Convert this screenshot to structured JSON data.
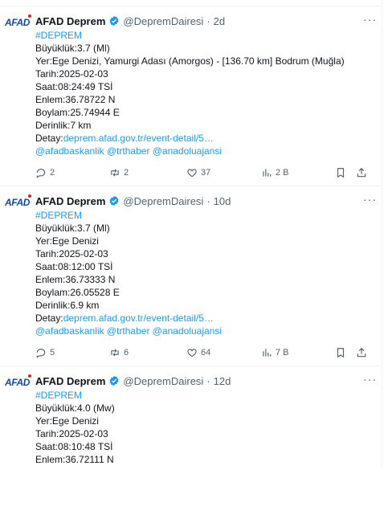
{
  "tweets": [
    {
      "author": "AFAD Deprem",
      "handle": "@DepremDairesi",
      "time": "2d",
      "avatar_text": "AFAD",
      "hashtag": "#DEPREM",
      "lines": [
        "Büyüklük:3.7 (Ml)",
        "Yer:Ege Denizi, Yamurgi Adası (Amorgos) - [136.70 km] Bodrum (Muğla)",
        "Tarih:2025-02-03",
        "Saat:08:24:49 TSİ",
        "Enlem:36.78722 N",
        "Boylam:25.74944 E",
        "Derinlik:7 km"
      ],
      "detail_label": "Detay:",
      "detail_link": "deprem.afad.gov.tr/event-detail/5…",
      "mentions": "@afadbaskanlik @trthaber @anadoluajansi",
      "replies": "2",
      "retweets": "2",
      "likes": "37",
      "views": "2 B"
    },
    {
      "author": "AFAD Deprem",
      "handle": "@DepremDairesi",
      "time": "10d",
      "avatar_text": "AFAD",
      "hashtag": "#DEPREM",
      "lines": [
        "Büyüklük:3.7 (Ml)",
        "Yer:Ege Denizi",
        "Tarih:2025-02-03",
        "Saat:08:12:00 TSİ",
        "Enlem:36.73333 N",
        "Boylam:26.05528 E",
        "Derinlik:6.9 km"
      ],
      "detail_label": "Detay:",
      "detail_link": "deprem.afad.gov.tr/event-detail/5…",
      "mentions": "@afadbaskanlik @trthaber @anadoluajansi",
      "replies": "5",
      "retweets": "6",
      "likes": "64",
      "views": "7 B"
    },
    {
      "author": "AFAD Deprem",
      "handle": "@DepremDairesi",
      "time": "12d",
      "avatar_text": "AFAD",
      "hashtag": "#DEPREM",
      "lines": [
        "Büyüklük:4.0 (Mw)",
        "Yer:Ege Denizi",
        "Tarih:2025-02-03",
        "Saat:08:10:48 TSİ",
        "Enlem:36.72111 N"
      ]
    }
  ],
  "colors": {
    "link": "#1d9bf0",
    "verified": "#1d9bf0",
    "muted": "#536471",
    "logo": "#14499b",
    "logo_dot": "#d7262b"
  },
  "icons": {
    "verified": "verified-badge-icon",
    "more": "more-horizontal-icon",
    "reply": "reply-bubble-icon",
    "retweet": "retweet-icon",
    "like": "heart-icon",
    "views": "views-bar-chart-icon",
    "bookmark": "bookmark-icon",
    "share": "share-icon"
  }
}
